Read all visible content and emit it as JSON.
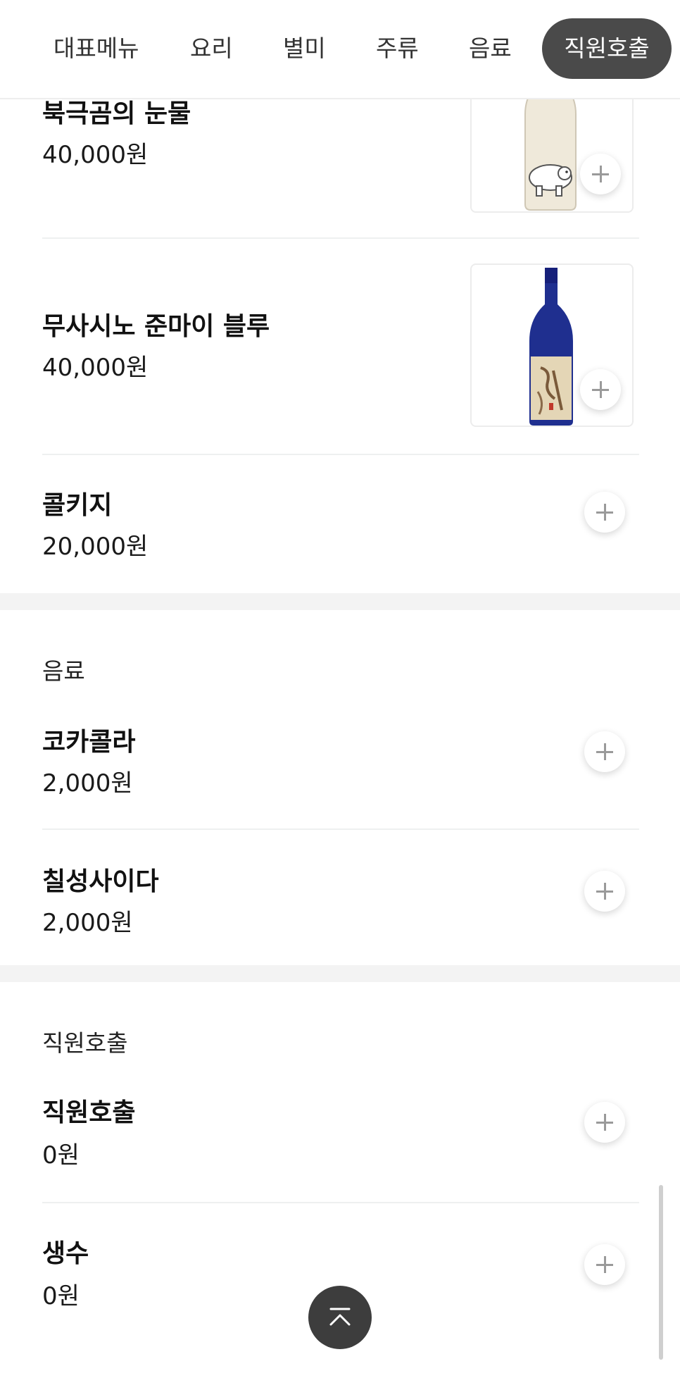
{
  "categories": {
    "tabs": [
      "대표메뉴",
      "요리",
      "별미",
      "주류",
      "음료"
    ],
    "active": "직원호출"
  },
  "liquor": {
    "items": [
      {
        "name": "북극곰의 눈물",
        "price": "40,000원",
        "image": "white-sake-bottle-polar-bear"
      },
      {
        "name": "무사시노 준마이 블루",
        "price": "40,000원",
        "image": "blue-sake-bottle"
      },
      {
        "name": "콜키지",
        "price": "20,000원"
      }
    ]
  },
  "drinks": {
    "title": "음료",
    "items": [
      {
        "name": "코카콜라",
        "price": "2,000원"
      },
      {
        "name": "칠성사이다",
        "price": "2,000원"
      }
    ]
  },
  "staff": {
    "title": "직원호출",
    "items": [
      {
        "name": "직원호출",
        "price": "0원"
      },
      {
        "name": "생수",
        "price": "0원"
      }
    ]
  },
  "icons": {
    "add": "plus-icon",
    "scroll_top": "chevron-up-icon"
  },
  "colors": {
    "active_tab_bg": "#4a4a4a",
    "scroll_top_bg": "#3d3d3d",
    "section_gap": "#f3f3f3"
  }
}
